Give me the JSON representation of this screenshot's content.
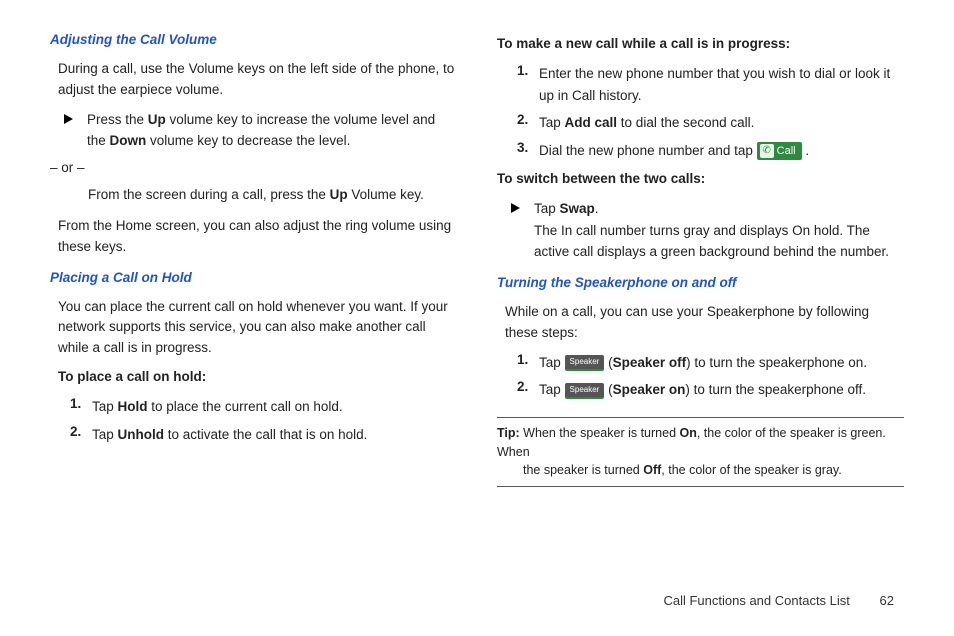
{
  "left": {
    "sec1_title": "Adjusting the Call Volume",
    "sec1_p1": "During a call, use the Volume keys on the left side of the phone, to adjust the earpiece volume.",
    "sec1_bul_a": "Press the ",
    "sec1_bul_b": "Up",
    "sec1_bul_c": " volume key to increase the volume level and the ",
    "sec1_bul_d": "Down",
    "sec1_bul_e": " volume key to decrease the level.",
    "sec1_or": "– or –",
    "sec1_from_a": "From the screen during a call, press the ",
    "sec1_from_b": "Up",
    "sec1_from_c": " Volume key.",
    "sec1_p2": "From the Home screen, you can also adjust the ring volume using these keys.",
    "sec2_title": "Placing a Call on Hold",
    "sec2_p1": "You can place the current call on hold whenever you want. If your network supports this service, you can also make another call while a call is in progress.",
    "sec2_head": "To place a call on hold:",
    "sec2_n1": "1.",
    "sec2_s1a": "Tap ",
    "sec2_s1b": "Hold",
    "sec2_s1c": " to place the current call on hold.",
    "sec2_n2": "2.",
    "sec2_s2a": "Tap ",
    "sec2_s2b": "Unhold",
    "sec2_s2c": " to activate the call that is on hold."
  },
  "right": {
    "head1": "To make a new call while a call is in progress:",
    "n1": "1.",
    "s1": "Enter the new phone number that you wish to dial or look it up in Call history.",
    "n2": "2.",
    "s2a": "Tap ",
    "s2b": "Add call",
    "s2c": " to dial the second call.",
    "n3": "3.",
    "s3a": "Dial the new phone number and tap ",
    "call_label": "Call",
    "s3b": " .",
    "head2": "To switch between the two calls:",
    "bul_a": "Tap ",
    "bul_b": "Swap",
    "bul_c": ".",
    "bul_p": "The In call number turns gray and displays On hold. The active call displays a green background behind the number.",
    "sec3_title": "Turning the Speakerphone on and off",
    "sec3_p1": "While on a call, you can use your Speakerphone by following these steps:",
    "sp_n1": "1.",
    "sp1a": "Tap ",
    "spk_btn1": "Speaker",
    "sp1b": " (",
    "sp1c": "Speaker off",
    "sp1d": ") to turn the speakerphone on.",
    "sp_n2": "2.",
    "sp2a": "Tap ",
    "spk_btn2": "Speaker",
    "sp2b": " (",
    "sp2c": "Speaker on",
    "sp2d": ") to turn the speakerphone off.",
    "tip_label": "Tip:",
    "tip_a": " When the speaker is turned ",
    "tip_b": "On",
    "tip_c": ", the color of the speaker is green. When ",
    "tip_d": "the speaker is turned ",
    "tip_e": "Off",
    "tip_f": ", the color of the speaker is gray."
  },
  "footer": {
    "section": "Call Functions and Contacts List",
    "page": "62"
  }
}
